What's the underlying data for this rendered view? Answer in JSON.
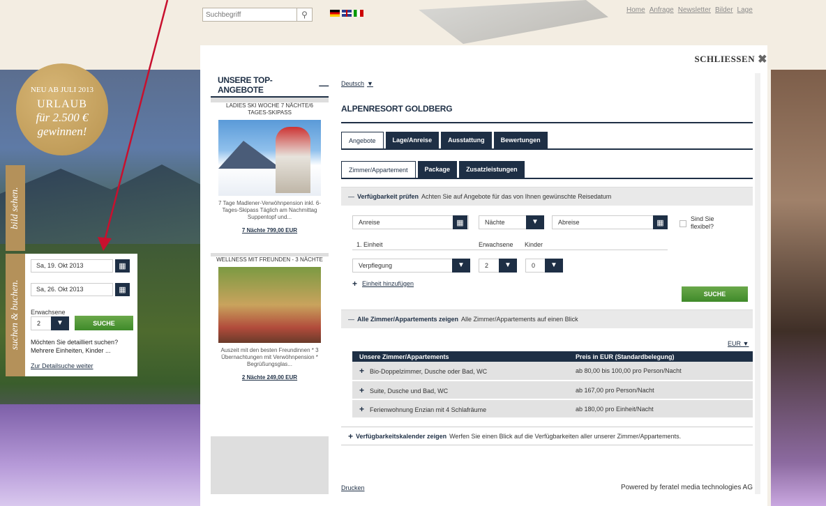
{
  "search": {
    "placeholder": "Suchbegriff",
    "icon": "magnifier"
  },
  "flags": [
    "de",
    "en",
    "it"
  ],
  "top_nav": [
    "Home",
    "Anfrage",
    "Newsletter",
    "Bilder",
    "Lage"
  ],
  "badge": {
    "line1": "NEU AB JULI 2013",
    "line2": "URLAUB",
    "line3": "für 2.500 €",
    "line4": "gewinnen!"
  },
  "side_tabs": {
    "bild": "bild sehen.",
    "suchen": "suchen & buchen."
  },
  "quick_search": {
    "arrival": "Sa, 19. Okt 2013",
    "departure": "Sa, 26. Okt 2013",
    "adults_label": "Erwachsene",
    "adults_value": "2",
    "search_button": "SUCHE",
    "detail_text": "Möchten Sie detailliert suchen? Mehrere Einheiten, Kinder ...",
    "detail_link": "Zur Detailsuche weiter"
  },
  "modal": {
    "close_label": "SCHLIESSEN",
    "offers_title": "UNSERE TOP-ANGEBOTE",
    "offers_dash": "—",
    "offers": [
      {
        "title": "LADIES SKI WOCHE 7 NÄCHTE/6 TAGES-SKIPASS",
        "description": "7 Tage Madlener-Verwöhnpension inkl. 6-Tages-Skipass Täglich am Nachmittag Suppentopf und...",
        "price": "7 Nächte 799,00 EUR"
      },
      {
        "title": "WELLNESS MIT FREUNDEN - 3 NÄCHTE",
        "description": "Auszeit mit den besten Freundinnen * 3 Übernachtungen mit Verwöhnpension * Begrüßungsglas...",
        "price": "2 Nächte 249,00 EUR"
      }
    ],
    "language": "Deutsch",
    "hotel_name": "ALPENRESORT GOLDBERG",
    "tabs": [
      "Angebote",
      "Lage/Anreise",
      "Ausstattung",
      "Bewertungen"
    ],
    "subtabs": [
      "Zimmer/Appartement",
      "Package",
      "Zusatzleistungen"
    ],
    "availability": {
      "toggle": "—",
      "title": "Verfügbarkeit prüfen",
      "subtitle": "Achten Sie auf Angebote für das von Ihnen gewünschte Reisedatum",
      "arrival_placeholder": "Anreise",
      "nights_placeholder": "Nächte",
      "departure_placeholder": "Abreise",
      "flexible_label": "Sind Sie flexibel?",
      "unit_label": "1. Einheit",
      "adults_label": "Erwachsene",
      "children_label": "Kinder",
      "board_placeholder": "Verpflegung",
      "adults_value": "2",
      "children_value": "0",
      "add_unit": "Einheit hinzufügen",
      "search_button": "SUCHE"
    },
    "rooms_section": {
      "toggle": "—",
      "title": "Alle Zimmer/Appartements zeigen",
      "subtitle": "Alle Zimmer/Appartements auf einen Blick",
      "currency": "EUR",
      "col_room": "Unsere Zimmer/Appartements",
      "col_price": "Preis in EUR (Standardbelegung)",
      "rows": [
        {
          "name": "Bio-Doppelzimmer, Dusche oder Bad, WC",
          "price": "ab 80,00 bis 100,00 pro Person/Nacht"
        },
        {
          "name": "Suite, Dusche und Bad, WC",
          "price": "ab 167,00 pro Person/Nacht"
        },
        {
          "name": "Ferienwohnung Enzian mit 4 Schlafräume",
          "price": "ab 180,00 pro Einheit/Nacht"
        }
      ]
    },
    "calendar_section": {
      "toggle": "+",
      "title": "Verfügbarkeitskalender zeigen",
      "subtitle": "Werfen Sie einen Blick auf die Verfügbarkeiten aller unserer Zimmer/Appartements."
    },
    "print_link": "Drucken",
    "powered_by": "Powered by feratel media technologies AG"
  },
  "colors": {
    "navy": "#1e2f45",
    "gold": "#b4915a",
    "green": "#4f9a35",
    "arrow": "#c8102e"
  }
}
